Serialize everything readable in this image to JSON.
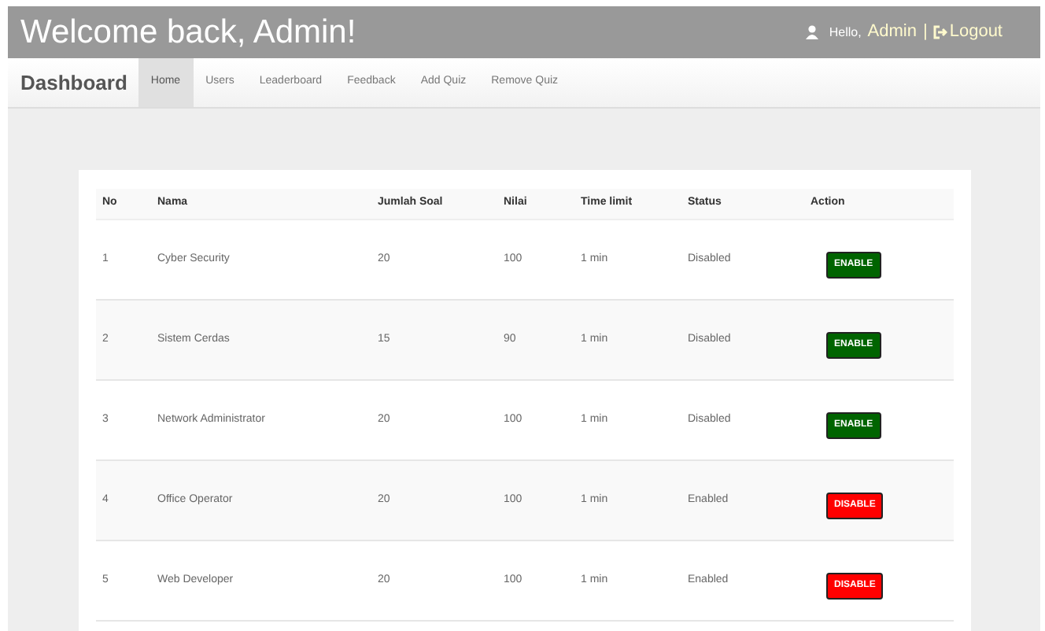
{
  "header": {
    "title": "Welcome back, Admin!",
    "greeting": "Hello,",
    "user": "Admin",
    "separator": "|",
    "logout": "Logout"
  },
  "nav": {
    "brand": "Dashboard",
    "items": [
      {
        "label": "Home",
        "selected": true
      },
      {
        "label": "Users",
        "selected": false
      },
      {
        "label": "Leaderboard",
        "selected": false
      },
      {
        "label": "Feedback",
        "selected": false
      },
      {
        "label": "Add Quiz",
        "selected": false
      },
      {
        "label": "Remove Quiz",
        "selected": false
      }
    ]
  },
  "table": {
    "columns": [
      "No",
      "Nama",
      "Jumlah Soal",
      "Nilai",
      "Time limit",
      "Status",
      "Action"
    ],
    "rows": [
      {
        "no": "1",
        "nama": "Cyber Security",
        "jumlah_soal": "20",
        "nilai": "100",
        "time_limit": "1 min",
        "status": "Disabled",
        "action": {
          "kind": "enable",
          "label": "ENABLE"
        }
      },
      {
        "no": "2",
        "nama": "Sistem Cerdas",
        "jumlah_soal": "15",
        "nilai": "90",
        "time_limit": "1 min",
        "status": "Disabled",
        "action": {
          "kind": "enable",
          "label": "ENABLE"
        }
      },
      {
        "no": "3",
        "nama": "Network Administrator",
        "jumlah_soal": "20",
        "nilai": "100",
        "time_limit": "1 min",
        "status": "Disabled",
        "action": {
          "kind": "enable",
          "label": "ENABLE"
        }
      },
      {
        "no": "4",
        "nama": "Office Operator",
        "jumlah_soal": "20",
        "nilai": "100",
        "time_limit": "1 min",
        "status": "Enabled",
        "action": {
          "kind": "disable",
          "label": "DISABLE"
        }
      },
      {
        "no": "5",
        "nama": "Web Developer",
        "jumlah_soal": "20",
        "nilai": "100",
        "time_limit": "1 min",
        "status": "Enabled",
        "action": {
          "kind": "disable",
          "label": "DISABLE"
        }
      }
    ]
  }
}
